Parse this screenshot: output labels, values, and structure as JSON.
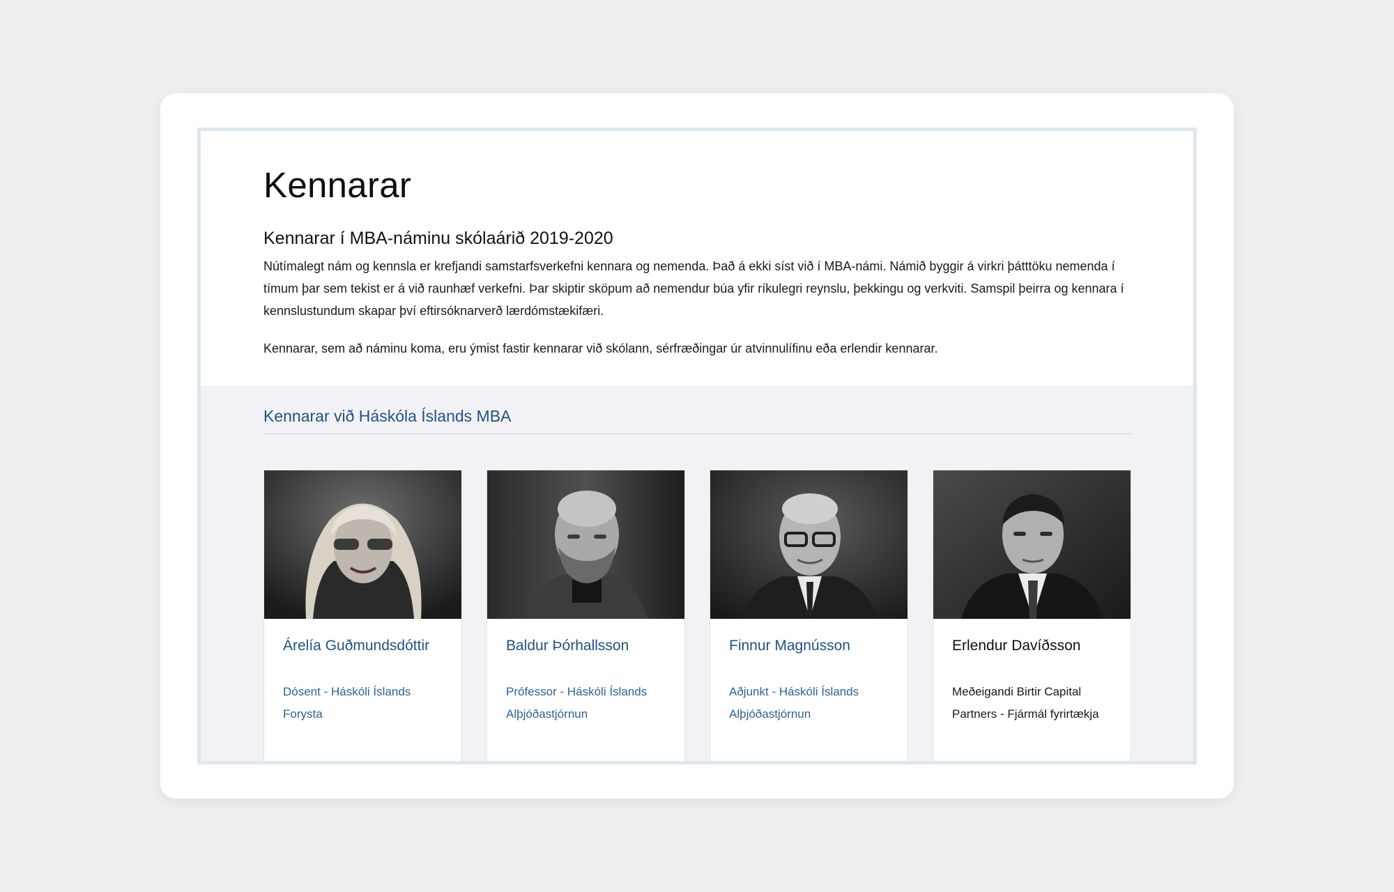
{
  "page": {
    "title": "Kennarar",
    "subtitle": "Kennarar í MBA-náminu skólaárið 2019-2020",
    "paragraphs": [
      "Nútímalegt nám og kennsla er krefjandi samstarfsverkefni kennara og nemenda. Það á ekki síst við í MBA-námi. Námið byggir á virkri þátttöku nemenda í tímum þar sem tekist er á við raunhæf verkefni. Þar skiptir sköpum að nemendur búa yfir ríkulegri reynslu, þekkingu og verkviti. Samspil þeirra og kennara í kennslustundum skapar því eftirsóknarverð lærdómstækifæri.",
      "Kennarar, sem að náminu koma, eru ýmist fastir kennarar við skólann, sérfræðingar úr atvinnulífinu eða erlendir kennarar."
    ]
  },
  "faculty": {
    "heading": "Kennarar við Háskóla Íslands MBA",
    "people": [
      {
        "name": "Árelía Guðmundsdóttir",
        "role_lines": [
          "Dósent - Háskóli Íslands",
          "Forysta"
        ],
        "photo_icon": "portrait-photo"
      },
      {
        "name": "Baldur Þórhallsson",
        "role_lines": [
          "Prófessor - Háskóli Íslands",
          "Alþjóðastjórnun"
        ],
        "photo_icon": "portrait-photo"
      },
      {
        "name": "Finnur Magnússon",
        "role_lines": [
          "Aðjunkt - Háskóli Íslands",
          " Alþjóðastjórnun"
        ],
        "photo_icon": "portrait-photo"
      },
      {
        "name": "Erlendur Davíðsson",
        "role_lines": [
          "Meðeigandi Birtir Capital Partners - Fjármál fyrirtækja"
        ],
        "photo_icon": "portrait-photo"
      }
    ]
  },
  "colors": {
    "link": "#1f5184",
    "section_bg": "#f2f2f6",
    "frame_border": "#dde7ef",
    "page_bg": "#efeff0"
  }
}
